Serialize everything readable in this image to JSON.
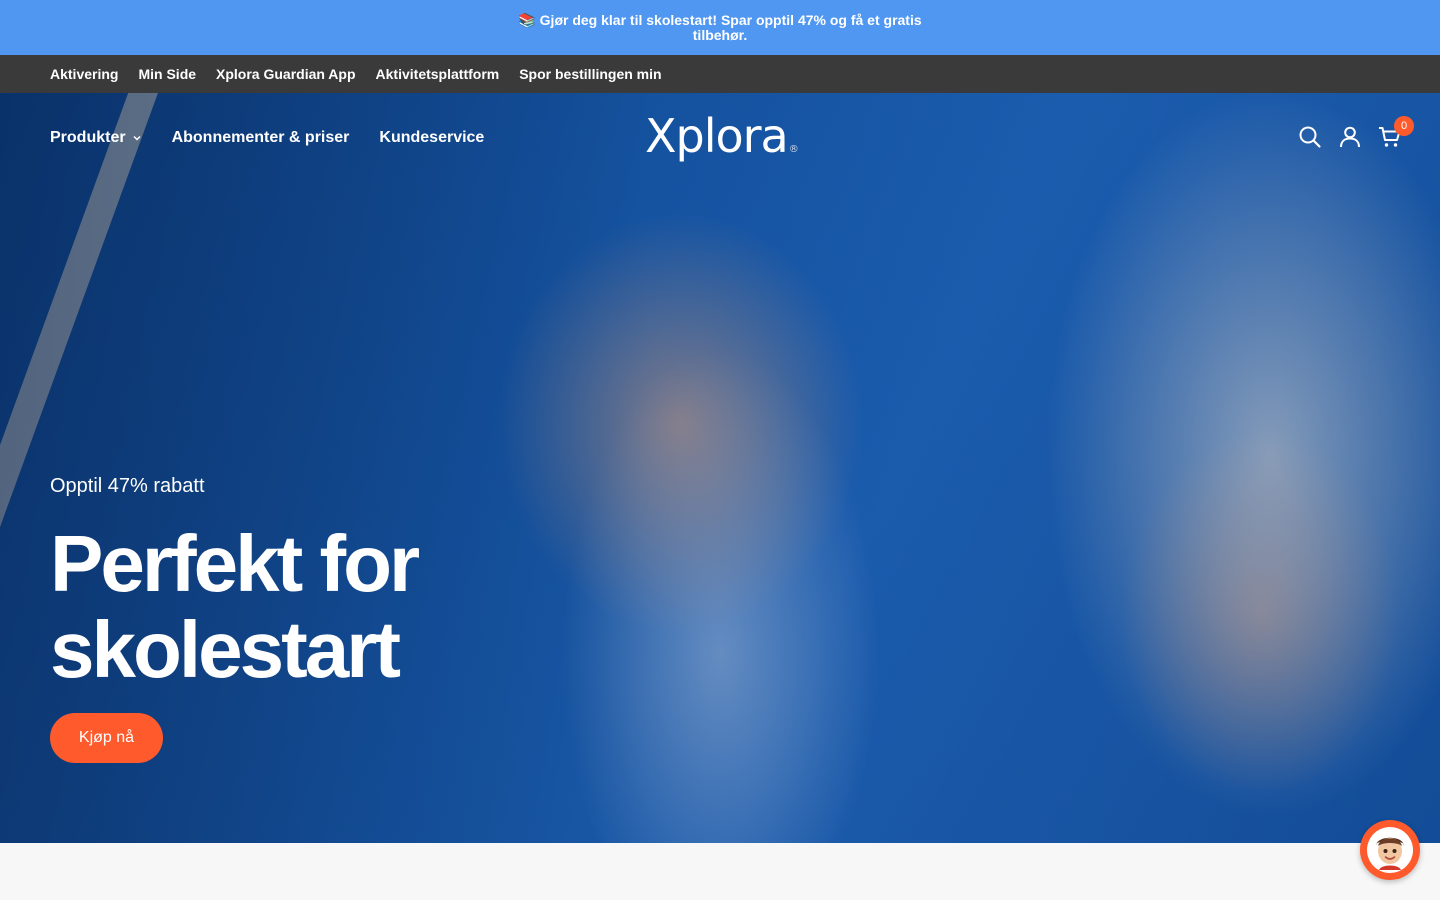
{
  "announcement": {
    "text": "📚 Gjør deg klar til skolestart! Spar opptil 47% og få et gratis tilbehør."
  },
  "top_nav": {
    "items": [
      {
        "label": "Aktivering"
      },
      {
        "label": "Min Side"
      },
      {
        "label": "Xplora Guardian App"
      },
      {
        "label": "Aktivitetsplattform"
      },
      {
        "label": "Spor bestillingen min"
      }
    ]
  },
  "main_nav": {
    "items": [
      {
        "label": "Produkter",
        "has_dropdown": true
      },
      {
        "label": "Abonnementer & priser"
      },
      {
        "label": "Kundeservice"
      }
    ]
  },
  "logo": {
    "text": "Xplora",
    "mark": "®"
  },
  "header_icons": {
    "search": "search-icon",
    "account": "user-icon",
    "cart": "cart-icon"
  },
  "cart": {
    "count": "0"
  },
  "hero": {
    "eyebrow": "Opptil 47% rabatt",
    "headline": "Perfekt for skolestart",
    "cta_label": "Kjøp nå"
  },
  "chat": {
    "icon": "chat-avatar-icon"
  },
  "colors": {
    "announcement_bg": "#4f97f0",
    "top_nav_bg": "#3a3a3a",
    "accent": "#ff5a2c",
    "text_on_dark": "#ffffff"
  }
}
